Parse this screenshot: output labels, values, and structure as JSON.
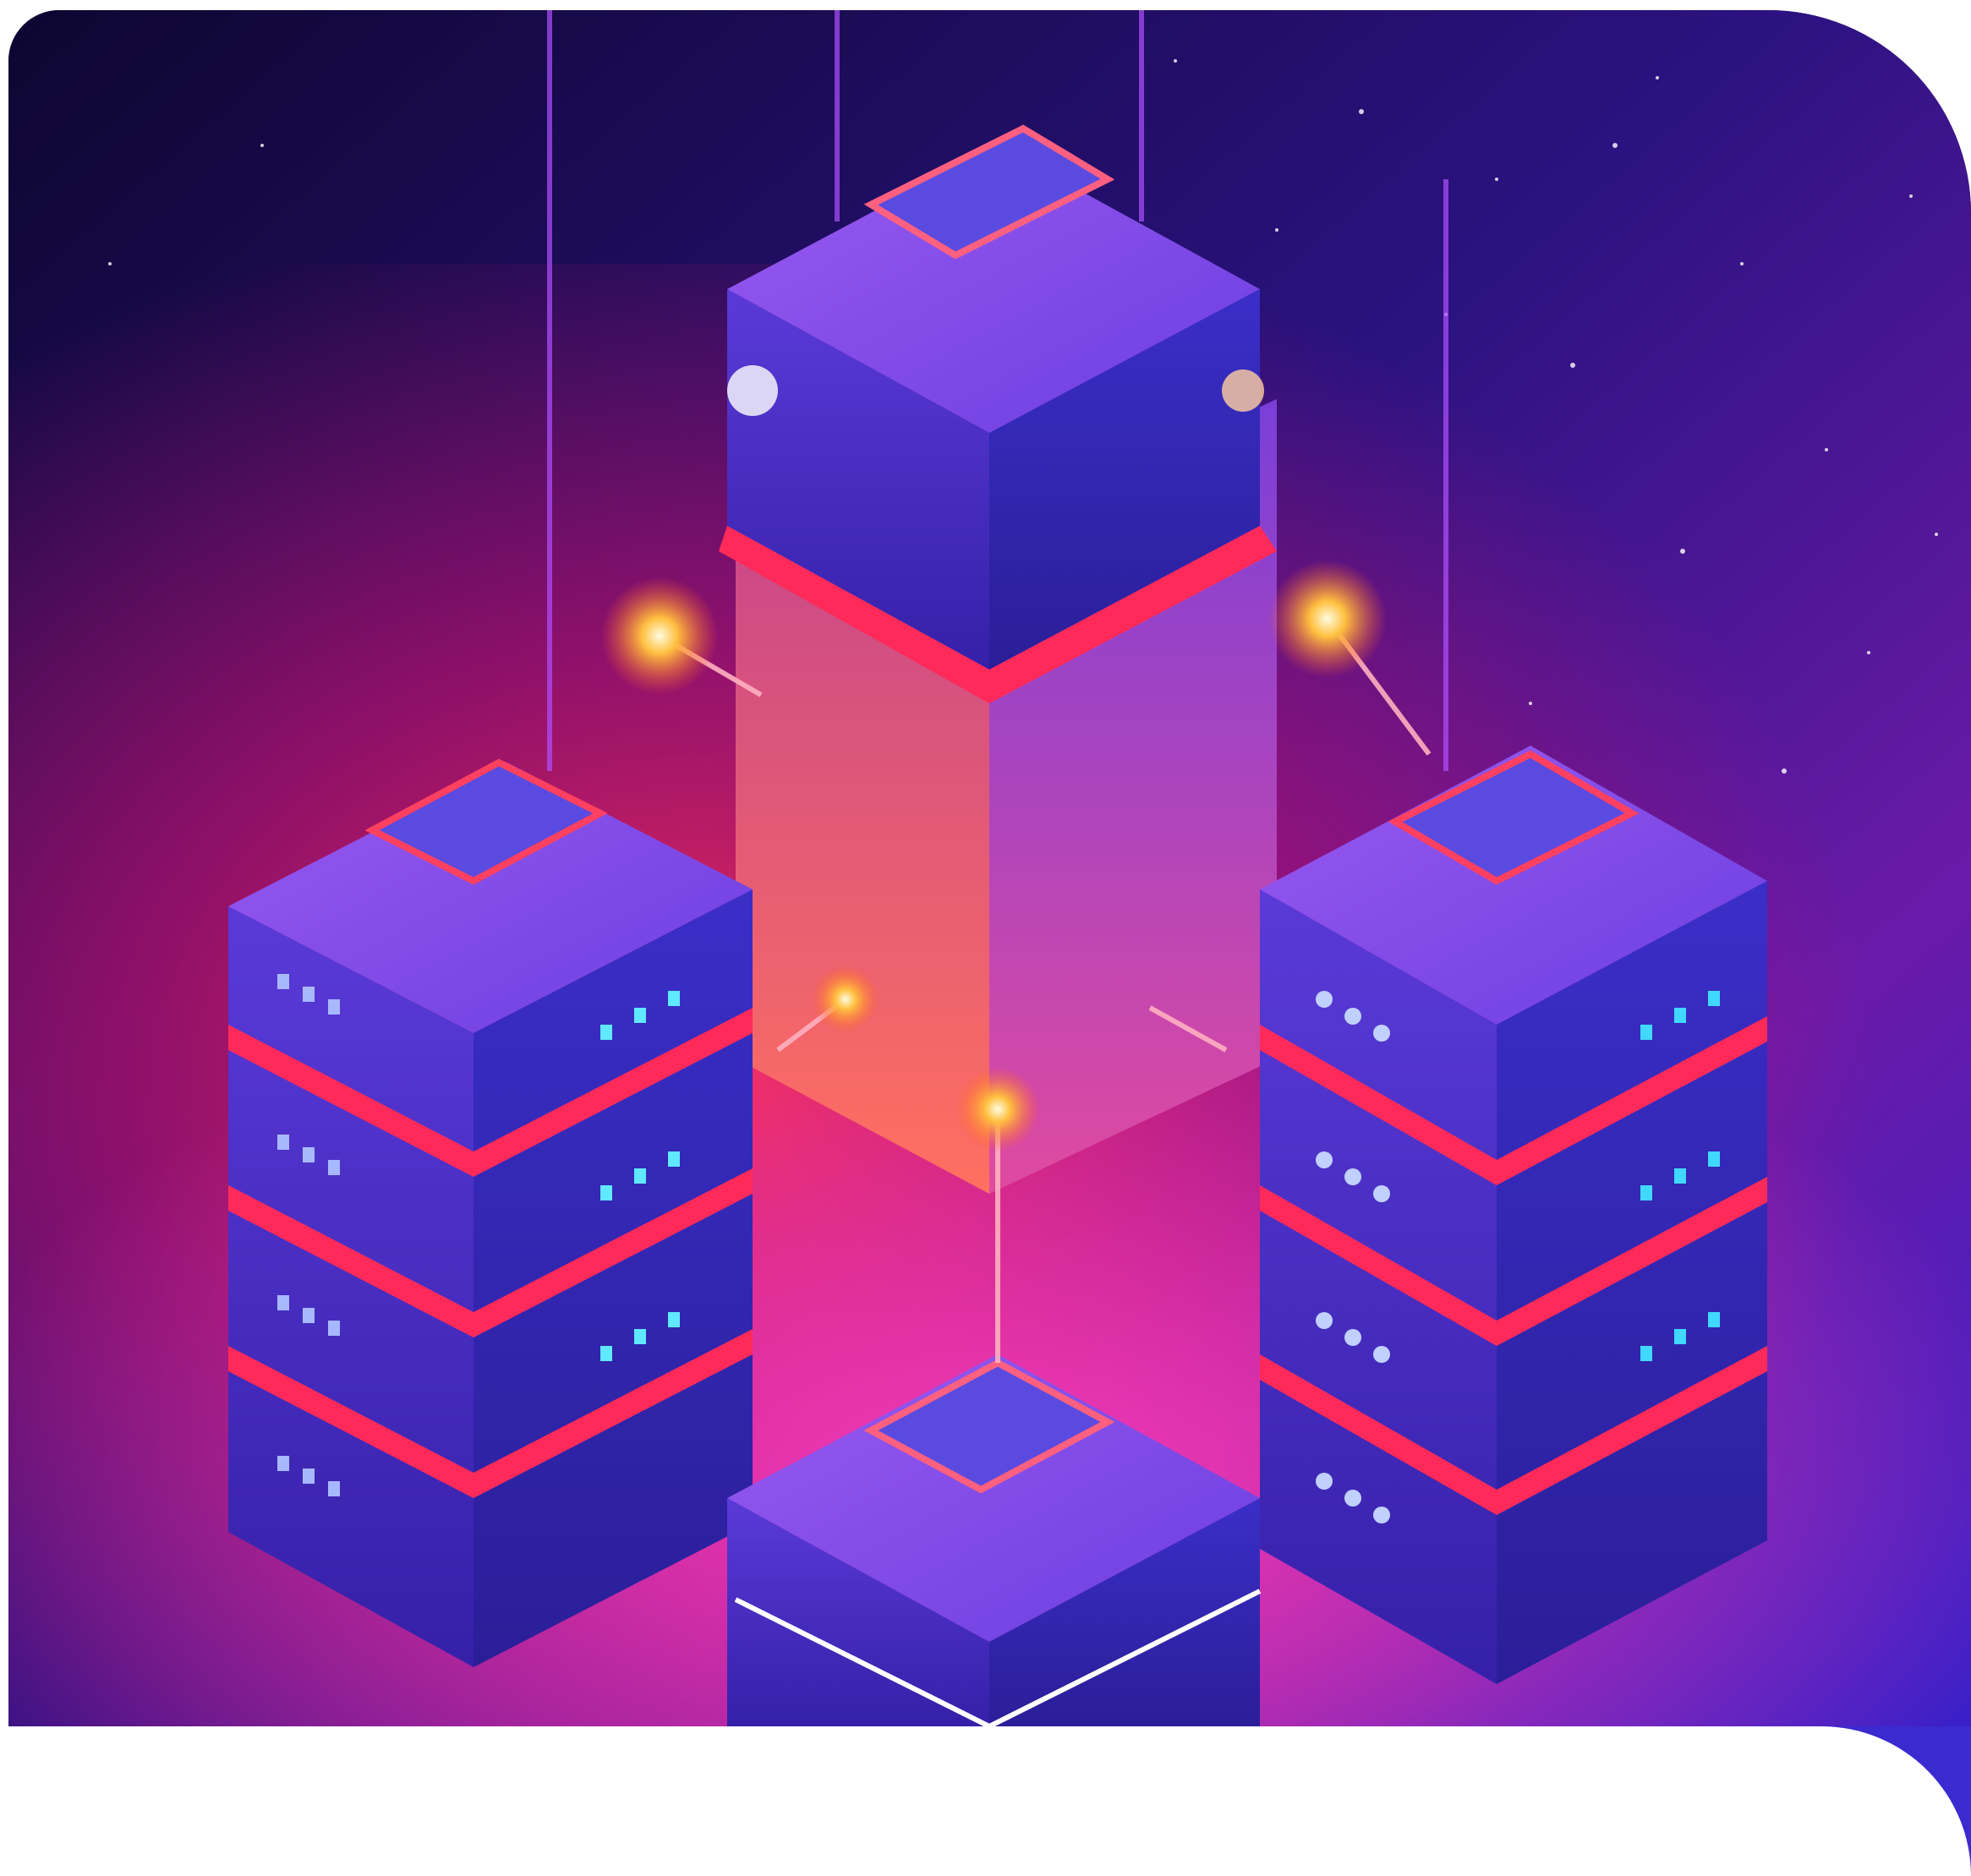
{
  "image": {
    "subject": "",
    "colors": {
      "sky_top": "#12082e",
      "sky_mid": "#2a1580",
      "glow_red": "#ff2a4a",
      "glow_magenta": "#e020c0",
      "server_blue": "#3b3bd8",
      "server_purple": "#7a3fe0",
      "light_orange": "#ffb040",
      "light_cyan": "#40e0ff",
      "background": "#ffffff"
    }
  }
}
